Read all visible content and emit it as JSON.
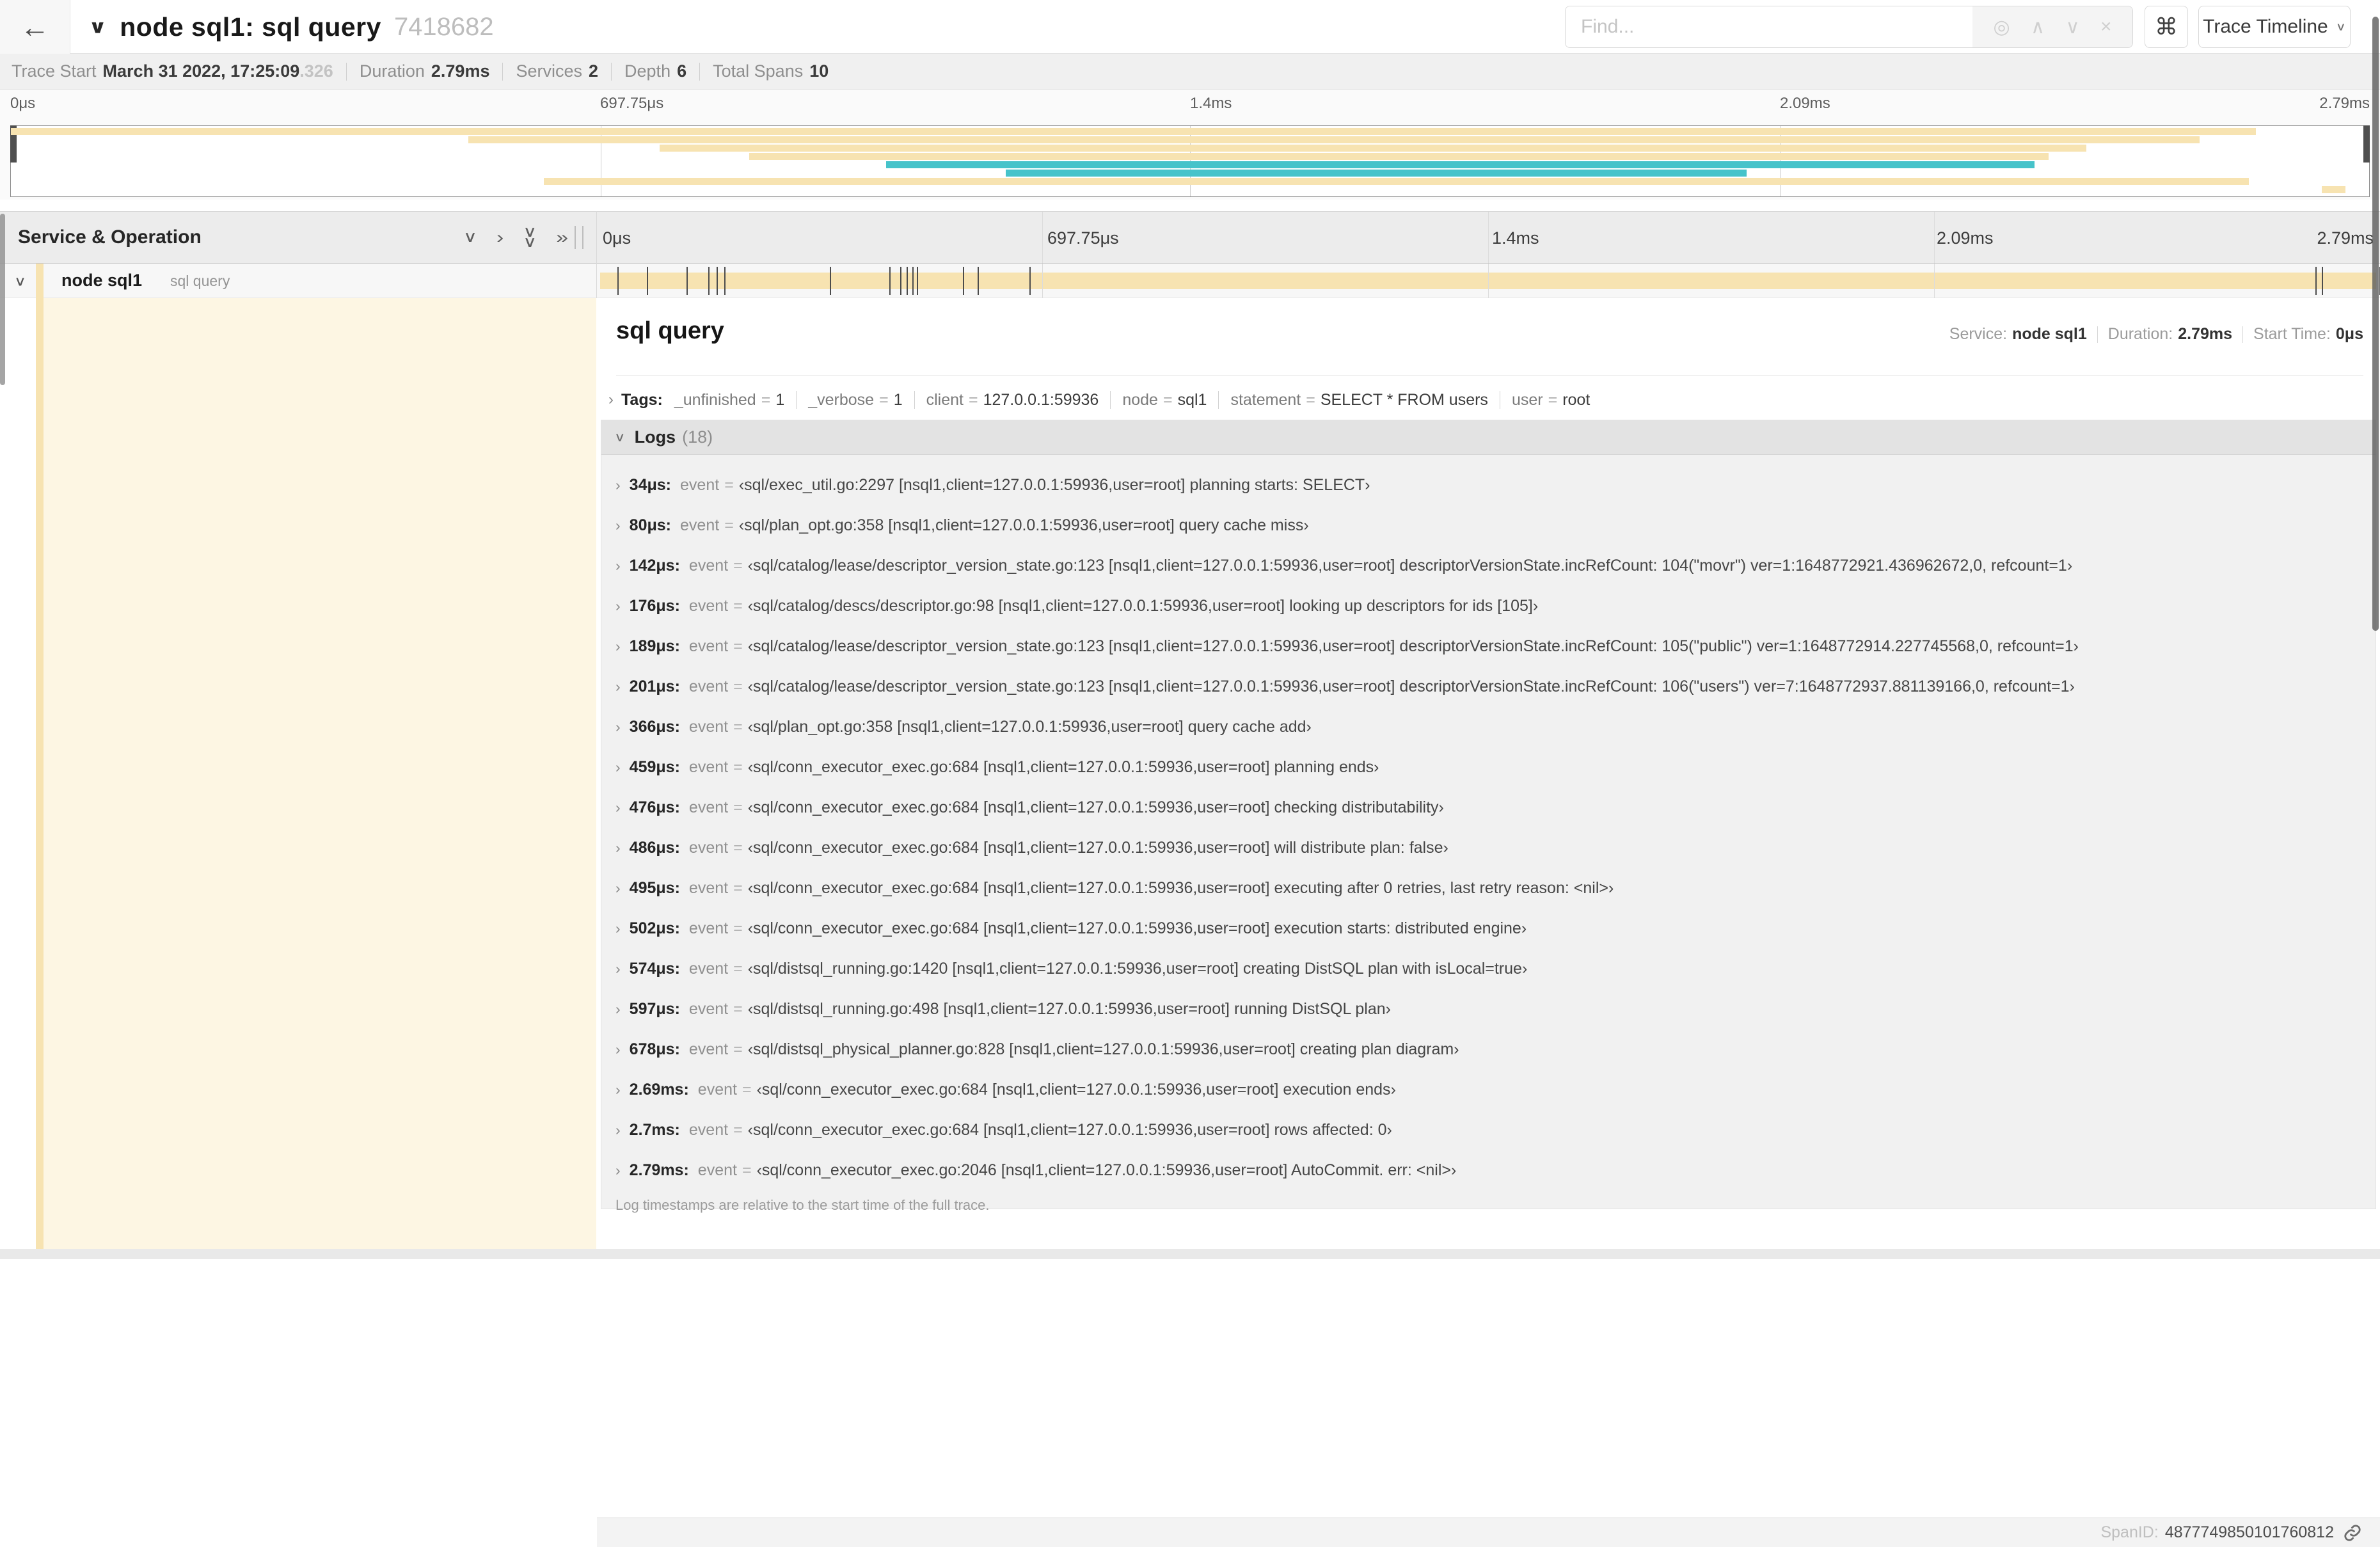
{
  "colors": {
    "tan": "#f7e3b1",
    "teal": "#46c3ca",
    "cream": "#fdf6e3"
  },
  "header": {
    "back_icon": "←",
    "title": "node sql1: sql query",
    "trace_id": "7418682",
    "find_placeholder": "Find...",
    "find_icons": [
      "◎",
      "∧",
      "∨",
      "×"
    ],
    "shortcut_button": "⌘",
    "view_button": "Trace Timeline"
  },
  "summary": {
    "trace_start_label": "Trace Start",
    "trace_start_value": "March 31 2022, 17:25:09",
    "trace_start_ms": ".326",
    "duration_label": "Duration",
    "duration_value": "2.79ms",
    "services_label": "Services",
    "services_value": "2",
    "depth_label": "Depth",
    "depth_value": "6",
    "total_spans_label": "Total Spans",
    "total_spans_value": "10"
  },
  "minimap": {
    "axis_ticks": [
      "0μs",
      "697.75μs",
      "1.4ms",
      "2.09ms",
      "2.79ms"
    ],
    "rows": [
      {
        "start": 0,
        "end": 95.2,
        "color": "tan"
      },
      {
        "start": 19.4,
        "end": 92.8,
        "color": "tan"
      },
      {
        "start": 27.5,
        "end": 88.0,
        "color": "tan"
      },
      {
        "start": 31.3,
        "end": 86.4,
        "color": "tan"
      },
      {
        "start": 37.1,
        "end": 85.8,
        "color": "teal"
      },
      {
        "start": 42.2,
        "end": 73.6,
        "color": "teal"
      },
      {
        "start": 22.6,
        "end": 94.9,
        "color": "tan"
      },
      {
        "start": 98.0,
        "end": 99.0,
        "color": "tan"
      }
    ]
  },
  "timeline": {
    "column_header": "Service & Operation",
    "collapse_icons": [
      "chevron-down",
      "chevron-right",
      "double-chevron-down",
      "double-chevron-right"
    ],
    "axis_ticks": [
      "0μs",
      "697.75μs",
      "1.4ms",
      "2.09ms",
      "2.79ms"
    ],
    "duration_us": 2790,
    "row": {
      "service": "node sql1",
      "operation": "sql query"
    }
  },
  "detail": {
    "operation": "sql query",
    "service_label": "Service:",
    "service_value": "node sql1",
    "duration_label": "Duration:",
    "duration_value": "2.79ms",
    "start_label": "Start Time:",
    "start_value": "0μs",
    "tags_label": "Tags:",
    "tags": [
      {
        "key": "_unfinished",
        "value": "1"
      },
      {
        "key": "_verbose",
        "value": "1"
      },
      {
        "key": "client",
        "value": "127.0.0.1:59936"
      },
      {
        "key": "node",
        "value": "sql1"
      },
      {
        "key": "statement",
        "value": "SELECT * FROM users"
      },
      {
        "key": "user",
        "value": "root"
      }
    ],
    "logs_label": "Logs",
    "logs_count": "(18)",
    "logs": [
      {
        "time": "34μs",
        "t_us": 34,
        "key": "event",
        "value": "‹sql/exec_util.go:2297 [nsql1,client=127.0.0.1:59936,user=root] planning starts: SELECT›"
      },
      {
        "time": "80μs",
        "t_us": 80,
        "key": "event",
        "value": "‹sql/plan_opt.go:358 [nsql1,client=127.0.0.1:59936,user=root] query cache miss›"
      },
      {
        "time": "142μs",
        "t_us": 142,
        "key": "event",
        "value": "‹sql/catalog/lease/descriptor_version_state.go:123 [nsql1,client=127.0.0.1:59936,user=root] descriptorVersionState.incRefCount: 104(\"movr\") ver=1:1648772921.436962672,0, refcount=1›"
      },
      {
        "time": "176μs",
        "t_us": 176,
        "key": "event",
        "value": "‹sql/catalog/descs/descriptor.go:98 [nsql1,client=127.0.0.1:59936,user=root] looking up descriptors for ids [105]›"
      },
      {
        "time": "189μs",
        "t_us": 189,
        "key": "event",
        "value": "‹sql/catalog/lease/descriptor_version_state.go:123 [nsql1,client=127.0.0.1:59936,user=root] descriptorVersionState.incRefCount: 105(\"public\") ver=1:1648772914.227745568,0, refcount=1›"
      },
      {
        "time": "201μs",
        "t_us": 201,
        "key": "event",
        "value": "‹sql/catalog/lease/descriptor_version_state.go:123 [nsql1,client=127.0.0.1:59936,user=root] descriptorVersionState.incRefCount: 106(\"users\") ver=7:1648772937.881139166,0, refcount=1›"
      },
      {
        "time": "366μs",
        "t_us": 366,
        "key": "event",
        "value": "‹sql/plan_opt.go:358 [nsql1,client=127.0.0.1:59936,user=root] query cache add›"
      },
      {
        "time": "459μs",
        "t_us": 459,
        "key": "event",
        "value": "‹sql/conn_executor_exec.go:684 [nsql1,client=127.0.0.1:59936,user=root] planning ends›"
      },
      {
        "time": "476μs",
        "t_us": 476,
        "key": "event",
        "value": "‹sql/conn_executor_exec.go:684 [nsql1,client=127.0.0.1:59936,user=root] checking distributability›"
      },
      {
        "time": "486μs",
        "t_us": 486,
        "key": "event",
        "value": "‹sql/conn_executor_exec.go:684 [nsql1,client=127.0.0.1:59936,user=root] will distribute plan: false›"
      },
      {
        "time": "495μs",
        "t_us": 495,
        "key": "event",
        "value": "‹sql/conn_executor_exec.go:684 [nsql1,client=127.0.0.1:59936,user=root] executing after 0 retries, last retry reason: <nil>›"
      },
      {
        "time": "502μs",
        "t_us": 502,
        "key": "event",
        "value": "‹sql/conn_executor_exec.go:684 [nsql1,client=127.0.0.1:59936,user=root] execution starts: distributed engine›"
      },
      {
        "time": "574μs",
        "t_us": 574,
        "key": "event",
        "value": "‹sql/distsql_running.go:1420 [nsql1,client=127.0.0.1:59936,user=root] creating DistSQL plan with isLocal=true›"
      },
      {
        "time": "597μs",
        "t_us": 597,
        "key": "event",
        "value": "‹sql/distsql_running.go:498 [nsql1,client=127.0.0.1:59936,user=root] running DistSQL plan›"
      },
      {
        "time": "678μs",
        "t_us": 678,
        "key": "event",
        "value": "‹sql/distsql_physical_planner.go:828 [nsql1,client=127.0.0.1:59936,user=root] creating plan diagram›"
      },
      {
        "time": "2.69ms",
        "t_us": 2690,
        "key": "event",
        "value": "‹sql/conn_executor_exec.go:684 [nsql1,client=127.0.0.1:59936,user=root] execution ends›"
      },
      {
        "time": "2.7ms",
        "t_us": 2700,
        "key": "event",
        "value": "‹sql/conn_executor_exec.go:684 [nsql1,client=127.0.0.1:59936,user=root] rows affected: 0›"
      },
      {
        "time": "2.79ms",
        "t_us": 2790,
        "key": "event",
        "value": "‹sql/conn_executor_exec.go:2046 [nsql1,client=127.0.0.1:59936,user=root] AutoCommit. err: <nil>›"
      }
    ],
    "note": "Log timestamps are relative to the start time of the full trace.",
    "span_id_label": "SpanID:",
    "span_id": "4877749850101760812"
  }
}
